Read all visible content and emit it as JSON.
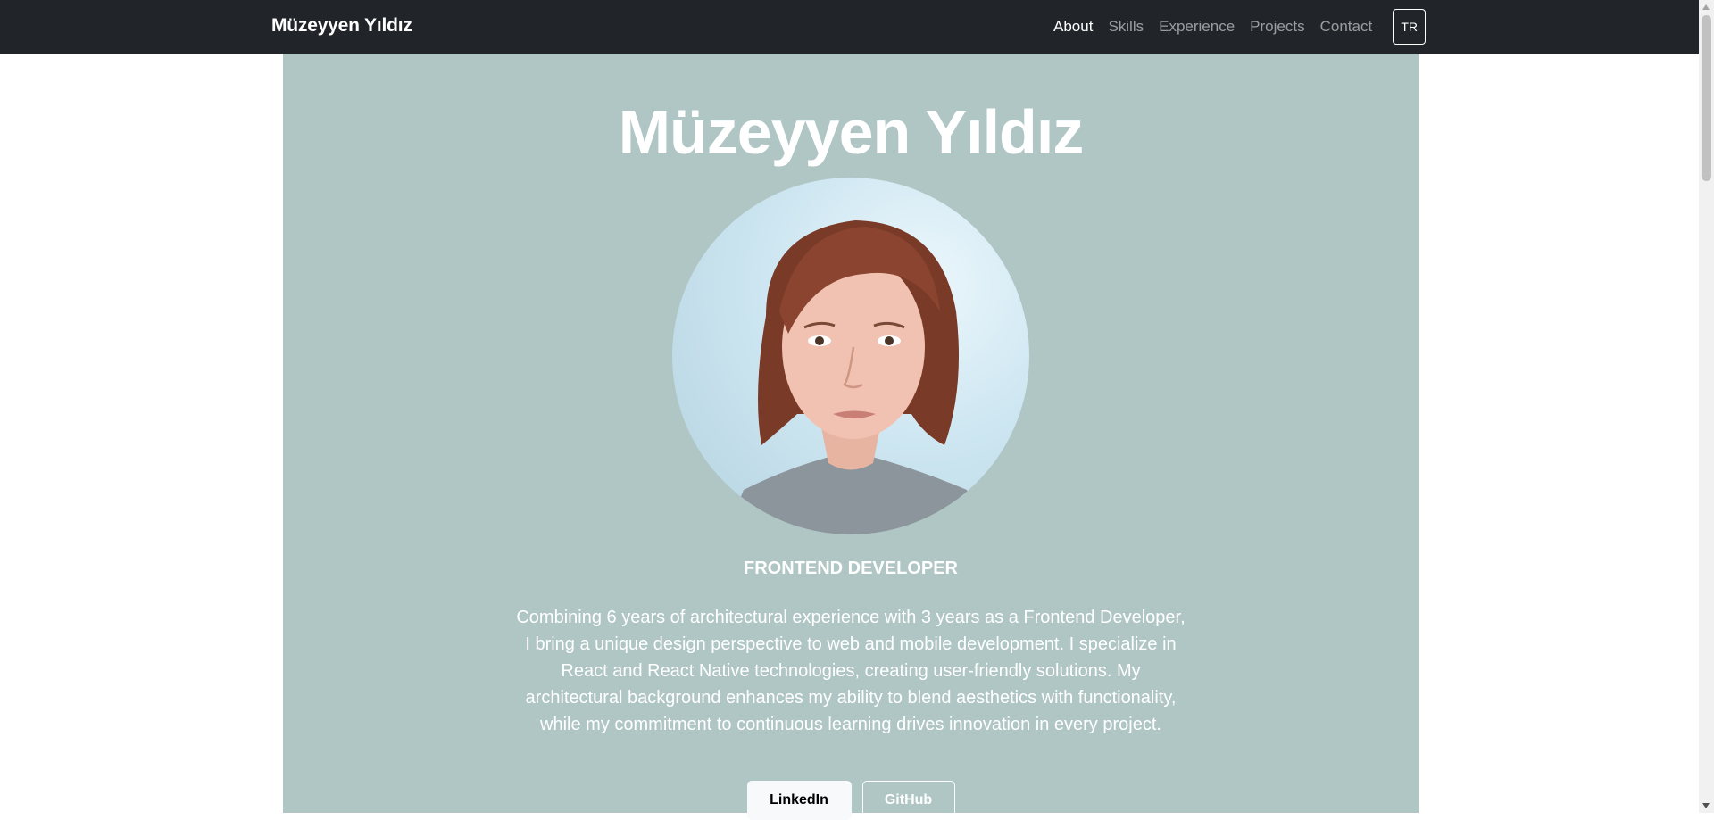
{
  "navbar": {
    "brand": "Müzeyyen Yıldız",
    "links": [
      {
        "label": "About",
        "active": true
      },
      {
        "label": "Skills",
        "active": false
      },
      {
        "label": "Experience",
        "active": false
      },
      {
        "label": "Projects",
        "active": false
      },
      {
        "label": "Contact",
        "active": false
      }
    ],
    "language_button": "TR"
  },
  "hero": {
    "title": "Müzeyyen Yıldız",
    "role": "FRONTEND DEVELOPER",
    "bio_lines": [
      "Combining 6 years of architectural experience with 3 years as a Frontend Developer,",
      "I bring a unique design perspective to web and mobile development. I specialize in",
      "React and React Native technologies, creating user-friendly solutions. My",
      "architectural background enhances my ability to blend aesthetics with functionality,",
      "while my commitment to continuous learning drives innovation in every project."
    ],
    "buttons": {
      "linkedin": "LinkedIn",
      "github": "GitHub"
    },
    "avatar_icon": "profile-photo"
  },
  "colors": {
    "navbar_bg": "#212529",
    "hero_bg": "#afc6c4",
    "text_light": "#ffffff"
  }
}
